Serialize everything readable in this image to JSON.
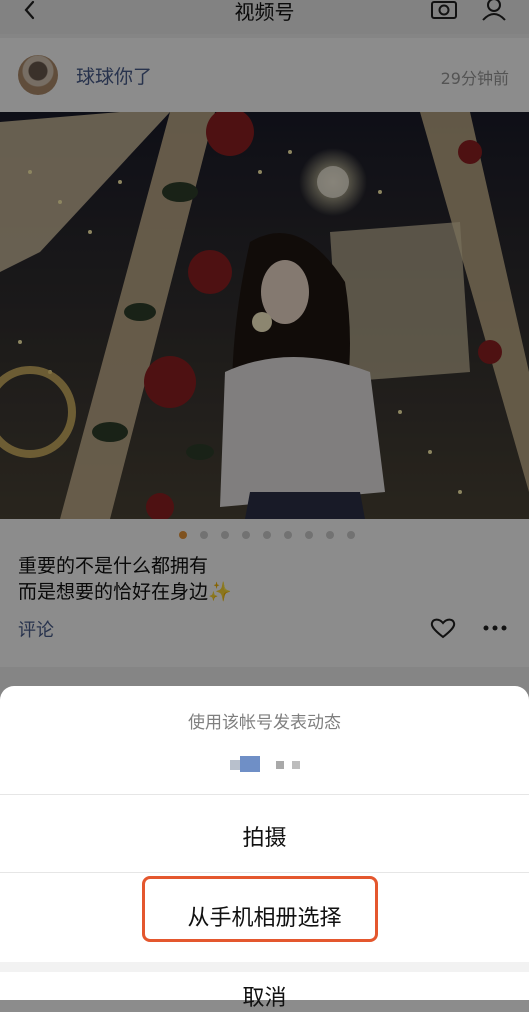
{
  "nav": {
    "title": "视频号"
  },
  "post": {
    "author": "球球你了",
    "time": "29分钟前",
    "caption_line1": "重要的不是什么都拥有",
    "caption_line2": "而是想要的恰好在身边✨",
    "comment_label": "评论",
    "pager": {
      "total": 9,
      "active": 1
    }
  },
  "sheet": {
    "title": "使用该帐号发表动态",
    "option_shoot": "拍摄",
    "option_album": "从手机相册选择",
    "option_cancel": "取消"
  },
  "colors": {
    "accent": "#e4572e",
    "link": "#4a5d8c",
    "pager_active": "#e8963a"
  }
}
